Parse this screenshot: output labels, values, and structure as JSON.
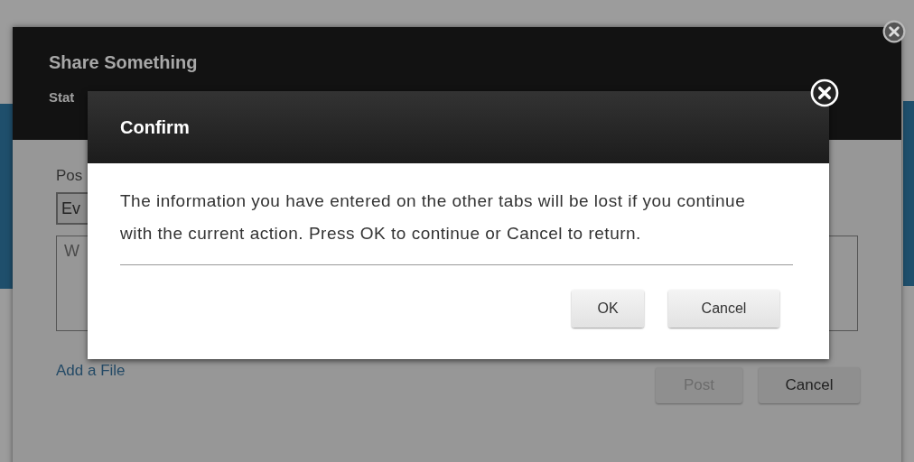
{
  "share_dialog": {
    "title": "Share Something",
    "tabs": [
      {
        "label": "Stat"
      }
    ],
    "post_label": "Pos",
    "visibility_select": {
      "value": "Ev"
    },
    "message_field": {
      "placeholder": "W"
    },
    "add_file_link": "Add a File",
    "buttons": [
      {
        "label": "Post",
        "disabled": true
      },
      {
        "label": "Cancel",
        "disabled": false
      }
    ]
  },
  "confirm_dialog": {
    "title": "Confirm",
    "message": "The information you have entered on the other tabs will be lost if you continue with the current action. Press OK to continue or Cancel to return.",
    "buttons": [
      {
        "label": "OK"
      },
      {
        "label": "Cancel"
      }
    ]
  }
}
